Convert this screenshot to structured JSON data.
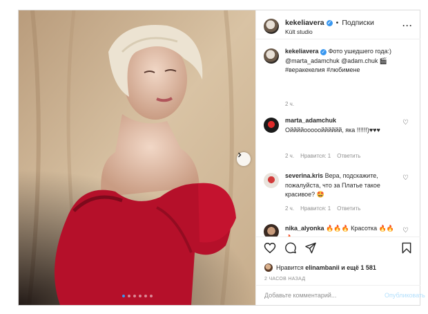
{
  "header": {
    "username": "kekeliavera",
    "separator": "•",
    "follow_label": "Подписки",
    "location": "Kült studio"
  },
  "comments": [
    {
      "username": "kekeliavera",
      "text": "Фото ушедшего года:) @marta_adamchuk @adam.chuk 🎬 #веракекелия #любимене",
      "time": "2 ч.",
      "verified": true
    },
    {
      "username": "marta_adamchuk",
      "text": "Оййййооооойййййй, яка !!!!!!)♥♥♥",
      "time": "2 ч.",
      "likes": "Нравится: 1",
      "reply": "Ответить"
    },
    {
      "username": "severina.kris",
      "text": "Вера, подскажите, пожалуйста, что за Платье такое красивое? 🤩",
      "time": "2 ч.",
      "likes": "Нравится: 1",
      "reply": "Ответить"
    },
    {
      "username": "nika_alyonka",
      "text": "🔥🔥🔥 Красотка 🔥🔥🔥"
    }
  ],
  "likes_line": {
    "prefix": "Нравится",
    "user": "elinambanii",
    "suffix": "и ещё 1 581"
  },
  "timestamp": "2 ЧАСОВ НАЗАД",
  "add_comment": {
    "placeholder": "Добавьте комментарий...",
    "publish_label": "Опубликовать"
  },
  "carousel": {
    "count": 6,
    "active_index": 0
  },
  "icons": [
    "heart-icon",
    "comment-icon",
    "share-icon",
    "bookmark-icon",
    "more-icon",
    "next-arrow-icon"
  ],
  "colors": {
    "accent": "#3897f0",
    "publish_disabled": "#b2dffc",
    "dress": "#b5102a"
  }
}
